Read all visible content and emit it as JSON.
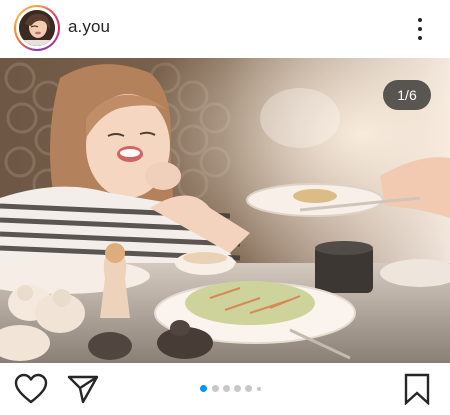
{
  "header": {
    "username": "a.you",
    "more_icon": "more-vertical-icon"
  },
  "carousel": {
    "counter": "1/6",
    "current_index": 1,
    "total": 6
  },
  "actions": {
    "like_icon": "heart-icon",
    "share_icon": "send-icon",
    "save_icon": "bookmark-icon"
  },
  "colors": {
    "active_dot": "#0095f6",
    "inactive_dot": "#c7c7c7",
    "text": "#262626"
  }
}
